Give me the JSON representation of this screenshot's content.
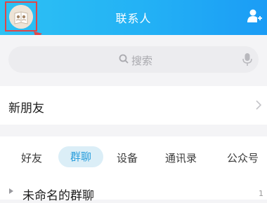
{
  "header": {
    "title": "联系人",
    "background_color": "#23b1f5",
    "avatar_icon": "avatar-icon",
    "add_user_icon": "add-contact-icon"
  },
  "search": {
    "placeholder": "搜索",
    "icon": "search-icon",
    "mic_icon": "mic-icon"
  },
  "new_friends": {
    "label": "新朋友",
    "chevron_icon": "chevron-right-icon"
  },
  "tabs": [
    {
      "label": "好友",
      "active": false
    },
    {
      "label": "群聊",
      "active": true
    },
    {
      "label": "设备",
      "active": false
    },
    {
      "label": "通讯录",
      "active": false
    },
    {
      "label": "公众号",
      "active": false
    }
  ],
  "groups": [
    {
      "label": "未命名的群聊",
      "count": "1",
      "expanded": false
    }
  ],
  "accent_color": "#2a9edc",
  "highlight_color": "#e14646"
}
